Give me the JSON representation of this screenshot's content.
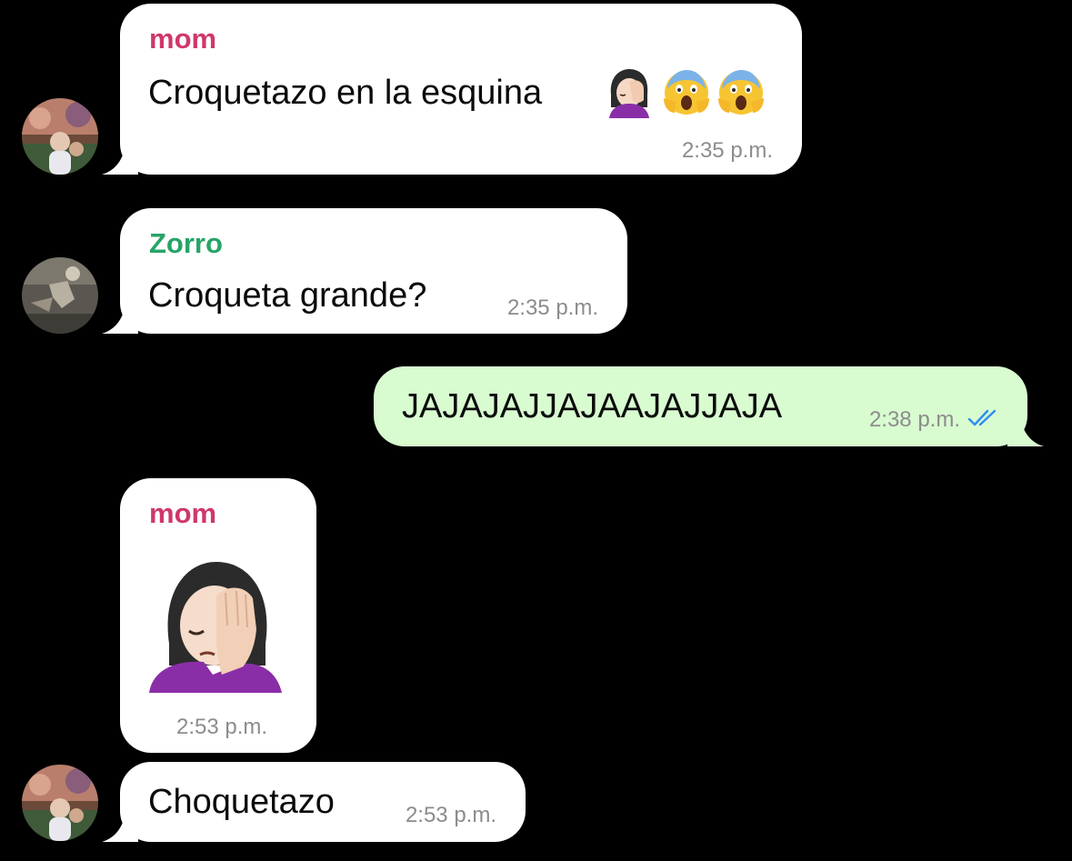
{
  "colors": {
    "background": "#000000",
    "incoming_bubble": "#ffffff",
    "outgoing_bubble": "#d8fbd0",
    "sender_mom": "#cf3869",
    "sender_zorro": "#27a467",
    "timestamp": "#8c8c8c",
    "read_ticks": "#2d8ef2"
  },
  "messages": [
    {
      "sender": "mom",
      "text": "Croquetazo en la esquina",
      "emojis": [
        "woman-facepalming-emoji",
        "face-screaming-in-fear-emoji",
        "face-screaming-in-fear-emoji"
      ],
      "time": "2:35 p.m."
    },
    {
      "sender": "Zorro",
      "text": "Croqueta grande?",
      "time": "2:35 p.m."
    },
    {
      "sender": "",
      "text": "JAJAJAJJAJAAJAJJAJA",
      "time": "2:38 p.m.",
      "status": "read-double-check-icon"
    },
    {
      "sender": "mom",
      "sticker": "woman-facepalming-emoji",
      "time": "2:53 p.m."
    },
    {
      "sender": "",
      "text": "Choquetazo",
      "time": "2:53 p.m."
    }
  ]
}
